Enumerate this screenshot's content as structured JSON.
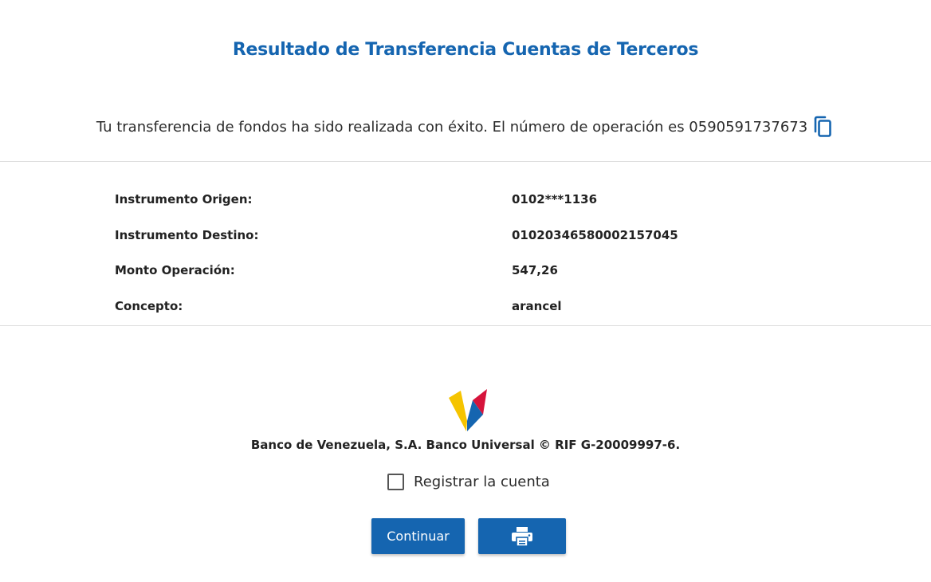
{
  "header": {
    "title": "Resultado de Transferencia Cuentas de Terceros"
  },
  "message": {
    "text": "Tu transferencia de fondos ha sido realizada con éxito. El número de operación es 0590591737673",
    "copy_icon": "copy-icon"
  },
  "details": [
    {
      "label": "Instrumento Origen:",
      "value": "0102***1136"
    },
    {
      "label": "Instrumento Destino:",
      "value": "01020346580002157045"
    },
    {
      "label": "Monto Operación:",
      "value": "547,26"
    },
    {
      "label": "Concepto:",
      "value": "arancel"
    }
  ],
  "footer": {
    "bank_text": "Banco de Venezuela, S.A. Banco Universal © RIF G-20009997-6.",
    "logo_colors": [
      "#f5c400",
      "#1565b0",
      "#d6133b"
    ]
  },
  "register": {
    "label": "Registrar la cuenta",
    "checked": false
  },
  "buttons": {
    "continue_label": "Continuar",
    "print_icon": "printer-icon"
  },
  "colors": {
    "accent": "#1565b0"
  }
}
